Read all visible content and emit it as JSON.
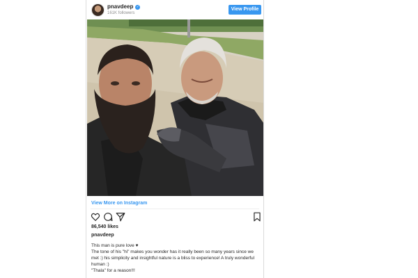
{
  "post": {
    "username": "pnavdeep",
    "verified_icon": "verified-badge-icon",
    "followers": "161K followers",
    "view_profile_label": "View Profile",
    "view_on_instagram": "View More on Instagram",
    "likes": "86,540 likes",
    "caption_username": "pnavdeep",
    "caption_lines": [
      "This man is pure love ♥",
      "The tone of his \"hi\" makes you wonder has it really been so many years since we",
      "met :) his simplicity and insightful nature is a bliss to experience! A truly wonderful",
      "human :)",
      "\"Thala\" for a reason!!!"
    ]
  },
  "icons": {
    "like": "heart-icon",
    "comment": "comment-icon",
    "share": "share-icon",
    "save": "bookmark-icon"
  },
  "colors": {
    "accent": "#3897f0",
    "text": "#262626",
    "muted": "#8e8e8e"
  }
}
